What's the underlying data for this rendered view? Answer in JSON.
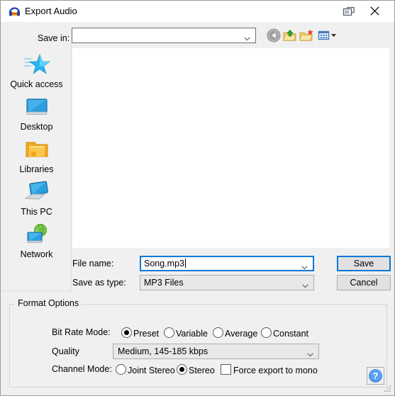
{
  "window": {
    "title": "Export Audio",
    "app_icon": "audacity-headphones-icon",
    "restore_icon": "restore-window-icon",
    "close_icon": "close-icon"
  },
  "navigation": {
    "save_in_label": "Save in:",
    "save_in_value": "",
    "toolbar": [
      {
        "name": "back-button",
        "icon": "back-arrow-icon",
        "tooltip": "Back"
      },
      {
        "name": "up-one-level-button",
        "icon": "folder-up-arrow-icon",
        "tooltip": "Up One Level"
      },
      {
        "name": "new-folder-button",
        "icon": "new-folder-icon",
        "tooltip": "Create New Folder"
      },
      {
        "name": "view-menu-button",
        "icon": "view-grid-icon",
        "tooltip": "View Menu"
      }
    ]
  },
  "places": [
    {
      "label": "Quick access",
      "icon": "quick-access-star-icon"
    },
    {
      "label": "Desktop",
      "icon": "desktop-monitor-icon"
    },
    {
      "label": "Libraries",
      "icon": "libraries-folder-icon"
    },
    {
      "label": "This PC",
      "icon": "this-pc-computer-icon"
    },
    {
      "label": "Network",
      "icon": "network-globe-icon"
    }
  ],
  "file_list": {
    "items": [],
    "empty": true
  },
  "file_fields": {
    "file_name_label": "File name:",
    "file_name_value": "Song.mp3",
    "save_as_type_label": "Save as type:",
    "save_as_type_value": "MP3 Files"
  },
  "buttons": {
    "save_label": "Save",
    "cancel_label": "Cancel",
    "help_label": "?"
  },
  "format_options": {
    "group_title": "Format Options",
    "bit_rate_mode_label": "Bit Rate Mode:",
    "bit_rate_modes": [
      {
        "label": "Preset",
        "selected": true
      },
      {
        "label": "Variable",
        "selected": false
      },
      {
        "label": "Average",
        "selected": false
      },
      {
        "label": "Constant",
        "selected": false
      }
    ],
    "quality_label": "Quality",
    "quality_value": "Medium, 145-185 kbps",
    "channel_mode_label": "Channel Mode:",
    "channel_modes": [
      {
        "label": "Joint Stereo",
        "selected": false
      },
      {
        "label": "Stereo",
        "selected": true
      }
    ],
    "force_mono_label": "Force export to mono",
    "force_mono_checked": false
  },
  "colors": {
    "accent": "#0078d7",
    "dialog_background": "#f0f0f0",
    "list_background": "#ffffff",
    "button_face": "#e1e1e1"
  }
}
